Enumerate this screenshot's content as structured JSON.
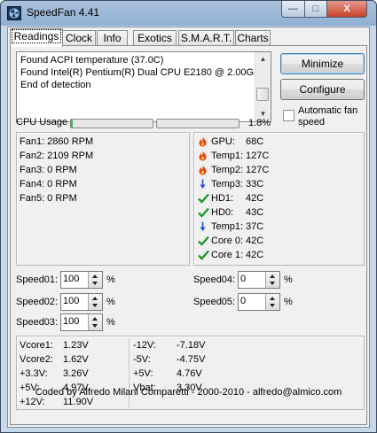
{
  "window": {
    "title": "SpeedFan 4.41",
    "icon": "fan-app-icon",
    "controls": {
      "minimize": "—",
      "maximize": "□",
      "close": "X"
    }
  },
  "tabs": [
    {
      "label": "Readings",
      "active": true
    },
    {
      "label": "Clock",
      "active": false
    },
    {
      "label": "Info",
      "active": false
    },
    {
      "label": "Exotics",
      "active": false
    },
    {
      "label": "S.M.A.R.T.",
      "active": false
    },
    {
      "label": "Charts",
      "active": false
    }
  ],
  "log": {
    "lines": [
      "Found ACPI temperature (37.0C)",
      "Found Intel(R) Pentium(R) Dual CPU E2180 @ 2.00GHz",
      "End of detection"
    ]
  },
  "buttons": {
    "minimize": "Minimize",
    "configure": "Configure"
  },
  "auto_fan": {
    "label": "Automatic fan speed",
    "label_line1": "Automatic fan",
    "label_line2": "speed",
    "checked": false
  },
  "cpu_usage": {
    "label": "CPU Usage",
    "value": "1.8%",
    "bar1_fraction": 0.02,
    "bar2_fraction": 0.0
  },
  "fans": [
    "Fan1: 2860 RPM",
    "Fan2: 2109 RPM",
    "Fan3: 0 RPM",
    "Fan4: 0 RPM",
    "Fan5: 0 RPM"
  ],
  "temps": [
    {
      "name": "GPU:",
      "value": "68C",
      "icon": "flame-icon",
      "color": "#e8471b"
    },
    {
      "name": "Temp1:",
      "value": "127C",
      "icon": "flame-icon",
      "color": "#e8471b"
    },
    {
      "name": "Temp2:",
      "value": "127C",
      "icon": "flame-icon",
      "color": "#e8471b"
    },
    {
      "name": "Temp3:",
      "value": "33C",
      "icon": "arrow-down-icon",
      "color": "#1e4fd8"
    },
    {
      "name": "HD1:",
      "value": "42C",
      "icon": "checkmark-icon",
      "color": "#1f9a2a"
    },
    {
      "name": "HD0:",
      "value": "43C",
      "icon": "checkmark-icon",
      "color": "#1f9a2a"
    },
    {
      "name": "Temp1:",
      "value": "37C",
      "icon": "arrow-down-icon",
      "color": "#1e4fd8"
    },
    {
      "name": "Core 0:",
      "value": "42C",
      "icon": "checkmark-icon",
      "color": "#1f9a2a"
    },
    {
      "name": "Core 1:",
      "value": "42C",
      "icon": "checkmark-icon",
      "color": "#1f9a2a"
    }
  ],
  "speeds": [
    {
      "label": "Speed01:",
      "value": "100",
      "unit": "%"
    },
    {
      "label": "Speed02:",
      "value": "100",
      "unit": "%"
    },
    {
      "label": "Speed03:",
      "value": "100",
      "unit": "%"
    },
    {
      "label": "Speed04:",
      "value": "0",
      "unit": "%"
    },
    {
      "label": "Speed05:",
      "value": "0",
      "unit": "%"
    }
  ],
  "voltages_left": [
    {
      "label": "Vcore1:",
      "value": "1.23V"
    },
    {
      "label": "Vcore2:",
      "value": "1.62V"
    },
    {
      "label": "+3.3V:",
      "value": "3.26V"
    },
    {
      "label": "+5V:",
      "value": "4.97V"
    },
    {
      "label": "+12V:",
      "value": "11.90V"
    }
  ],
  "voltages_right": [
    {
      "label": "-12V:",
      "value": "-7.18V"
    },
    {
      "label": "-5V:",
      "value": "-4.75V"
    },
    {
      "label": "+5V:",
      "value": "4.76V"
    },
    {
      "label": "Vbat:",
      "value": "3.30V"
    }
  ],
  "footer": "Coded by Alfredo Milani Comparetti - 2000-2010 - alfredo@almico.com"
}
